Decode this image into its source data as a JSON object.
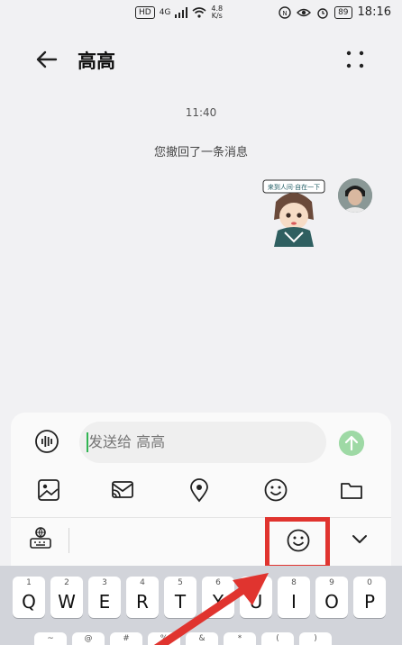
{
  "status_bar": {
    "hd_badge": "HD",
    "network": "4G",
    "net_speed_value": "4.8",
    "net_speed_unit": "K/s",
    "battery": "89",
    "time": "18:16",
    "icons": [
      "signal-icon",
      "wifi-icon",
      "nfc-icon",
      "eye-icon",
      "alarm-icon",
      "battery-icon"
    ]
  },
  "header": {
    "title": "高高",
    "back_icon": "arrow-left-icon",
    "more_icon": "more-dots-icon"
  },
  "chat": {
    "timestamp": "11:40",
    "recall_notice": "您撤回了一条消息",
    "sticker_caption": "来到人间·自在一下"
  },
  "input": {
    "placeholder": "发送给 高高",
    "tools": [
      "image-icon",
      "cast-icon",
      "location-icon",
      "emoji-icon",
      "folder-icon"
    ]
  },
  "keyboard": {
    "row1": [
      {
        "hint": "1",
        "ch": "Q"
      },
      {
        "hint": "2",
        "ch": "W"
      },
      {
        "hint": "3",
        "ch": "E"
      },
      {
        "hint": "4",
        "ch": "R"
      },
      {
        "hint": "5",
        "ch": "T"
      },
      {
        "hint": "6",
        "ch": "Y"
      },
      {
        "hint": "7",
        "ch": "U"
      },
      {
        "hint": "8",
        "ch": "I"
      },
      {
        "hint": "9",
        "ch": "O"
      },
      {
        "hint": "0",
        "ch": "P"
      }
    ],
    "row2_hints": [
      "~",
      "@",
      "#",
      "%",
      "&",
      "*",
      "(",
      ")"
    ]
  },
  "colors": {
    "highlight": "#e0342f",
    "send_button": "#9ed9a5",
    "caret": "#31b553"
  }
}
